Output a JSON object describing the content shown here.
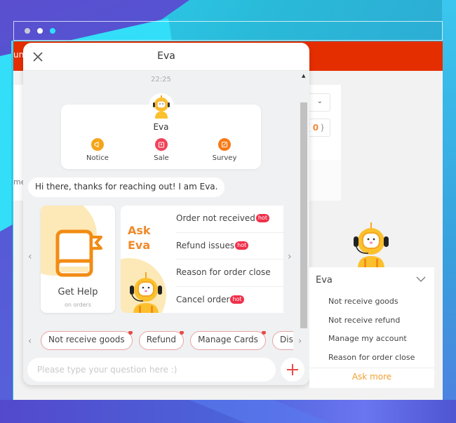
{
  "window": {
    "dots": [
      "gray",
      "white",
      "cyan"
    ],
    "colors": {
      "header": "#e52e00",
      "accent": "#f08a2a",
      "hot": "#f0304a",
      "plus": "#e84848",
      "ask_more": "#f0a030"
    }
  },
  "background_app": {
    "header_text_fragment": "un",
    "side_text_fragment": "me",
    "count_open": "(",
    "count_value": "0",
    "count_close": ")"
  },
  "chat": {
    "title": "Eva",
    "timestamp": "22:25",
    "profile": {
      "name": "Eva",
      "quick_actions": [
        {
          "label": "Notice",
          "icon": "megaphone-icon",
          "color": "#f4a51c"
        },
        {
          "label": "Sale",
          "icon": "bag-icon",
          "color": "#f0445a"
        },
        {
          "label": "Survey",
          "icon": "edit-icon",
          "color": "#f57a18"
        }
      ]
    },
    "greeting": "Hi there, thanks for reaching out! I am Eva.",
    "help_card": {
      "title": "Get Help",
      "subtitle": "on orders"
    },
    "ask_card": {
      "title_line1": "Ask",
      "title_line2": "Eva",
      "faqs": [
        {
          "label": "Order not received",
          "hot": "hot"
        },
        {
          "label": "Refund issues",
          "hot": "hot"
        },
        {
          "label": "Reason for order close",
          "hot": null
        },
        {
          "label": "Cancel order",
          "hot": "hot"
        }
      ]
    },
    "chips": [
      "Not receive goods",
      "Refund",
      "Manage Cards",
      "Dispute"
    ],
    "input_placeholder": "Please type your question here :)"
  },
  "widget": {
    "title": "Eva",
    "items": [
      "Not receive goods",
      "Not receive refund",
      "Manage my account",
      "Reason for order close"
    ],
    "ask_more": "Ask more"
  }
}
